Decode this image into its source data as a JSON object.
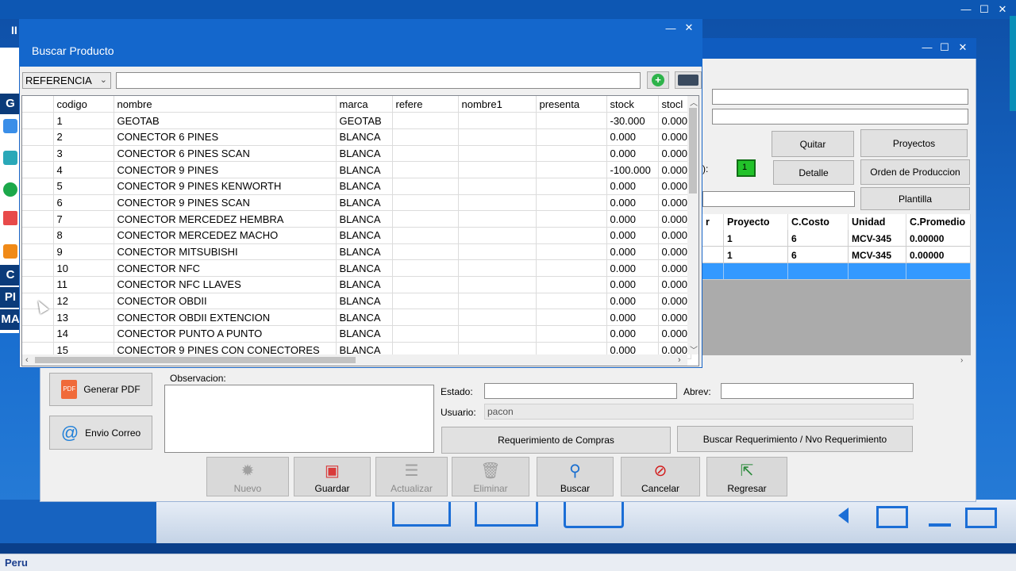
{
  "outer": {
    "title_char": "II",
    "controls": [
      "—",
      "☐",
      "✕"
    ]
  },
  "left_strip": [
    "G",
    "C",
    "PI",
    "MA"
  ],
  "main_form": {
    "buttons": {
      "quitar": "Quitar",
      "proyectos": "Proyectos",
      "detalle": "Detalle",
      "orden": "Orden de Produccion",
      "plantilla": "Plantilla"
    },
    "paren_label": "):",
    "green_value": "1",
    "grid_headers": [
      "r",
      "Proyecto",
      "C.Costo",
      "Unidad",
      "C.Promedio"
    ],
    "grid_rows": [
      [
        "",
        "1",
        "6",
        "MCV-345",
        "0.00000"
      ],
      [
        "",
        "1",
        "6",
        "MCV-345",
        "0.00000"
      ]
    ],
    "generar_pdf": "Generar PDF",
    "envio_correo": "Envio Correo",
    "observacion_label": "Observacion:",
    "estado_label": "Estado:",
    "abrev_label": "Abrev:",
    "usuario_label": "Usuario:",
    "usuario_value": "pacon",
    "req_compras": "Requerimiento de Compras",
    "buscar_req": "Buscar Requerimiento / Nvo Requerimiento",
    "toolbar": [
      {
        "label": "Nuevo",
        "icon": "new-icon",
        "disabled": true
      },
      {
        "label": "Guardar",
        "icon": "save-icon",
        "disabled": false
      },
      {
        "label": "Actualizar",
        "icon": "update-icon",
        "disabled": true
      },
      {
        "label": "Eliminar",
        "icon": "trash-icon",
        "disabled": true
      },
      {
        "label": "Buscar",
        "icon": "search-icon",
        "disabled": false
      },
      {
        "label": "Cancelar",
        "icon": "cancel-icon",
        "disabled": false
      },
      {
        "label": "Regresar",
        "icon": "exit-icon",
        "disabled": false
      }
    ]
  },
  "dialog": {
    "title": "Buscar Producto",
    "combo_value": "REFERENCIA",
    "search_value": "",
    "headers": [
      "codigo",
      "nombre",
      "marca",
      "refere",
      "nombre1",
      "presenta",
      "stock",
      "stocl"
    ],
    "rows": [
      [
        "1",
        "GEOTAB",
        "GEOTAB",
        "",
        "",
        "",
        "-30.000",
        "0.000"
      ],
      [
        "2",
        "CONECTOR 6 PINES",
        "BLANCA",
        "",
        "",
        "",
        "0.000",
        "0.000"
      ],
      [
        "3",
        "CONECTOR 6 PINES SCAN",
        "BLANCA",
        "",
        "",
        "",
        "0.000",
        "0.000"
      ],
      [
        "4",
        "CONECTOR 9 PINES",
        "BLANCA",
        "",
        "",
        "",
        "-100.000",
        "0.000"
      ],
      [
        "5",
        "CONECTOR 9 PINES KENWORTH",
        "BLANCA",
        "",
        "",
        "",
        "0.000",
        "0.000"
      ],
      [
        "6",
        "CONECTOR 9 PINES SCAN",
        "BLANCA",
        "",
        "",
        "",
        "0.000",
        "0.000"
      ],
      [
        "7",
        "CONECTOR MERCEDEZ HEMBRA",
        "BLANCA",
        "",
        "",
        "",
        "0.000",
        "0.000"
      ],
      [
        "8",
        "CONECTOR MERCEDEZ MACHO",
        "BLANCA",
        "",
        "",
        "",
        "0.000",
        "0.000"
      ],
      [
        "9",
        "CONECTOR MITSUBISHI",
        "BLANCA",
        "",
        "",
        "",
        "0.000",
        "0.000"
      ],
      [
        "10",
        "CONECTOR NFC",
        "BLANCA",
        "",
        "",
        "",
        "0.000",
        "0.000"
      ],
      [
        "11",
        "CONECTOR NFC LLAVES",
        "BLANCA",
        "",
        "",
        "",
        "0.000",
        "0.000"
      ],
      [
        "12",
        "CONECTOR OBDII",
        "BLANCA",
        "",
        "",
        "",
        "0.000",
        "0.000"
      ],
      [
        "13",
        "CONECTOR OBDII EXTENCION",
        "BLANCA",
        "",
        "",
        "",
        "0.000",
        "0.000"
      ],
      [
        "14",
        "CONECTOR PUNTO A PUNTO",
        "BLANCA",
        "",
        "",
        "",
        "0.000",
        "0.000"
      ],
      [
        "15",
        "CONECTOR 9 PINES CON CONECTORES",
        "BLANCA",
        "",
        "",
        "",
        "0.000",
        "0.000"
      ]
    ]
  },
  "status": {
    "region": "Peru"
  },
  "colors": {
    "title_blue": "#1467cc",
    "select_blue": "#3399ff",
    "green_box": "#22c22a"
  }
}
